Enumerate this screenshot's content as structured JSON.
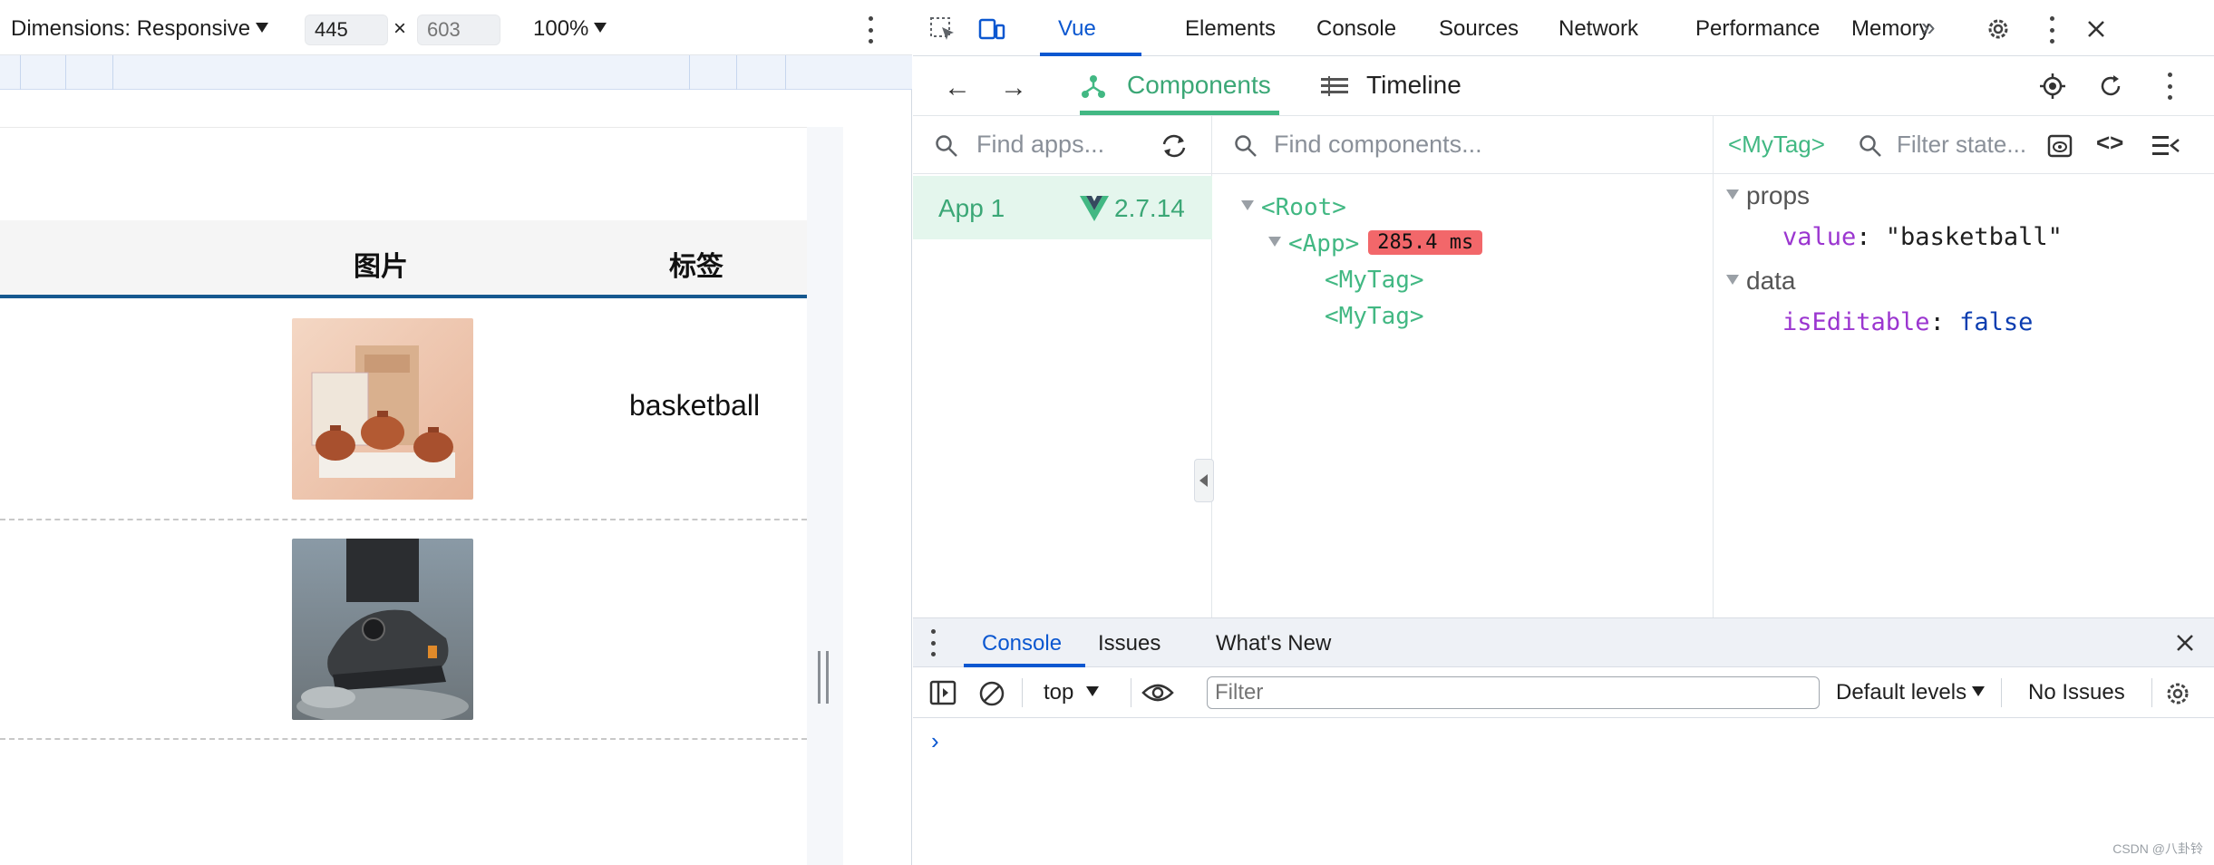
{
  "device_toolbar": {
    "dimensions_label": "Dimensions: Responsive",
    "width_value": "445",
    "height_placeholder": "603",
    "times": "×",
    "zoom": "100%"
  },
  "page_table": {
    "headers": [
      "图片",
      "标签"
    ],
    "rows": [
      {
        "image": "teapot-set-photo",
        "tag": "basketball"
      },
      {
        "image": "hiking-shoe-photo",
        "tag": ""
      }
    ]
  },
  "devtools": {
    "tabs": [
      "Vue",
      "Elements",
      "Console",
      "Sources",
      "Network",
      "Performance",
      "Memory"
    ],
    "more": "»",
    "active_tab": "Vue"
  },
  "vue": {
    "tabs": {
      "components": "Components",
      "timeline": "Timeline"
    },
    "apps_search_placeholder": "Find apps...",
    "components_search_placeholder": "Find components...",
    "app": {
      "name": "App 1",
      "version": "2.7.14"
    },
    "tree": {
      "root": "<Root>",
      "app": "<App>",
      "app_time": "285.4 ms",
      "child1": "<MyTag>",
      "child2": "<MyTag>"
    },
    "inspector": {
      "selected": "<MyTag>",
      "filter_placeholder": "Filter state...",
      "props_label": "props",
      "prop_key": "value",
      "prop_value": "\"basketball\"",
      "data_label": "data",
      "data_key": "isEditable",
      "data_value": "false"
    }
  },
  "drawer": {
    "tabs": [
      "Console",
      "Issues",
      "What's New"
    ],
    "context": "top",
    "filter_placeholder": "Filter",
    "levels": "Default levels",
    "issues": "No Issues",
    "prompt": "›"
  },
  "watermark": "CSDN @八卦铃",
  "colors": {
    "vue_green": "#42b883",
    "chrome_blue": "#0b57d0",
    "badge_red": "#f2676a",
    "prop_purple": "#9b36d0"
  }
}
